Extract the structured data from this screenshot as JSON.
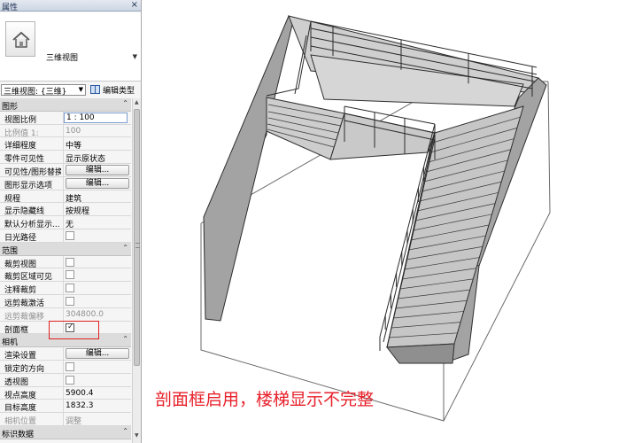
{
  "palette": {
    "title": "属性",
    "close": "×",
    "type_name": "三维视图",
    "view_selector": "三维视图: {三维}",
    "edit_type_label": "编辑类型"
  },
  "groups": {
    "graphics": "图形",
    "extents": "范围",
    "camera": "相机",
    "identity": "标识数据"
  },
  "graphics_rows": [
    {
      "name": "视图比例",
      "value": "1 : 100",
      "kind": "boxed"
    },
    {
      "name": "比例值 1:",
      "value": "100",
      "kind": "dim"
    },
    {
      "name": "详细程度",
      "value": "中等",
      "kind": "text"
    },
    {
      "name": "零件可见性",
      "value": "显示原状态",
      "kind": "text"
    },
    {
      "name": "可见性/图形替换",
      "value": "编辑...",
      "kind": "button"
    },
    {
      "name": "图形显示选项",
      "value": "编辑...",
      "kind": "button"
    },
    {
      "name": "规程",
      "value": "建筑",
      "kind": "text"
    },
    {
      "name": "显示隐藏线",
      "value": "按规程",
      "kind": "text"
    },
    {
      "name": "默认分析显示...",
      "value": "无",
      "kind": "text"
    },
    {
      "name": "日光路径",
      "value": "",
      "kind": "checkbox",
      "checked": false
    }
  ],
  "extents_rows": [
    {
      "name": "裁剪视图",
      "kind": "checkbox",
      "checked": false
    },
    {
      "name": "裁剪区域可见",
      "kind": "checkbox",
      "checked": false
    },
    {
      "name": "注释裁剪",
      "kind": "checkbox",
      "checked": false
    },
    {
      "name": "远剪裁激活",
      "kind": "checkbox",
      "checked": false
    },
    {
      "name": "远剪裁偏移",
      "value": "304800.0",
      "kind": "dim"
    },
    {
      "name": "剖面框",
      "kind": "checkbox",
      "checked": true
    }
  ],
  "camera_rows": [
    {
      "name": "渲染设置",
      "value": "编辑...",
      "kind": "button"
    },
    {
      "name": "锁定的方向",
      "kind": "checkbox",
      "checked": false
    },
    {
      "name": "透视图",
      "kind": "checkbox",
      "checked": false
    },
    {
      "name": "视点高度",
      "value": "5900.4",
      "kind": "text"
    },
    {
      "name": "目标高度",
      "value": "1832.3",
      "kind": "text"
    },
    {
      "name": "相机位置",
      "value": "调整",
      "kind": "dim"
    }
  ],
  "annotation": "剖面框启用，楼梯显示不完整",
  "colors": {
    "wall": "#a3a3a3",
    "floor": "#d2d2d2",
    "annotation": "#e8202a",
    "highlight_box": "#e02020"
  },
  "icons": {
    "type_preview": "house-icon",
    "edit_type": "edit-type-icon",
    "group_toggle": "chevron-up-icon"
  }
}
